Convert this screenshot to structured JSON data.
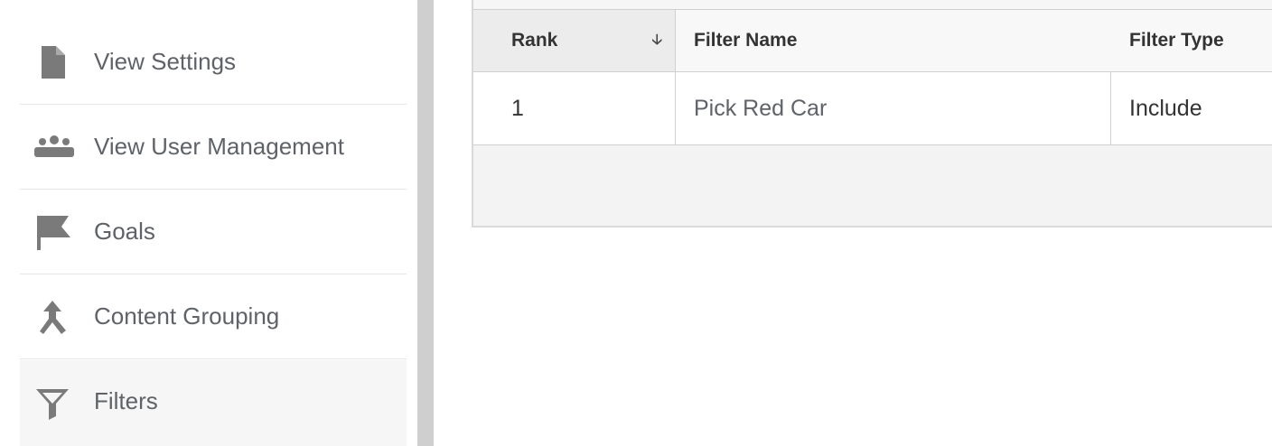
{
  "sidebar": {
    "items": [
      {
        "label": "View Settings",
        "icon": "document-icon"
      },
      {
        "label": "View User Management",
        "icon": "users-icon"
      },
      {
        "label": "Goals",
        "icon": "flag-icon"
      },
      {
        "label": "Content Grouping",
        "icon": "merge-icon"
      },
      {
        "label": "Filters",
        "icon": "filter-icon",
        "active": true
      }
    ]
  },
  "table": {
    "columns": {
      "rank": "Rank",
      "name": "Filter Name",
      "type": "Filter Type"
    },
    "sort_icon": "arrow-down-icon",
    "rows": [
      {
        "rank": "1",
        "name": "Pick Red Car",
        "type": "Include"
      }
    ]
  },
  "colors": {
    "icon_gray": "#7a7a7a",
    "label_gray": "#5f6368",
    "divider": "#cfcfcf"
  }
}
